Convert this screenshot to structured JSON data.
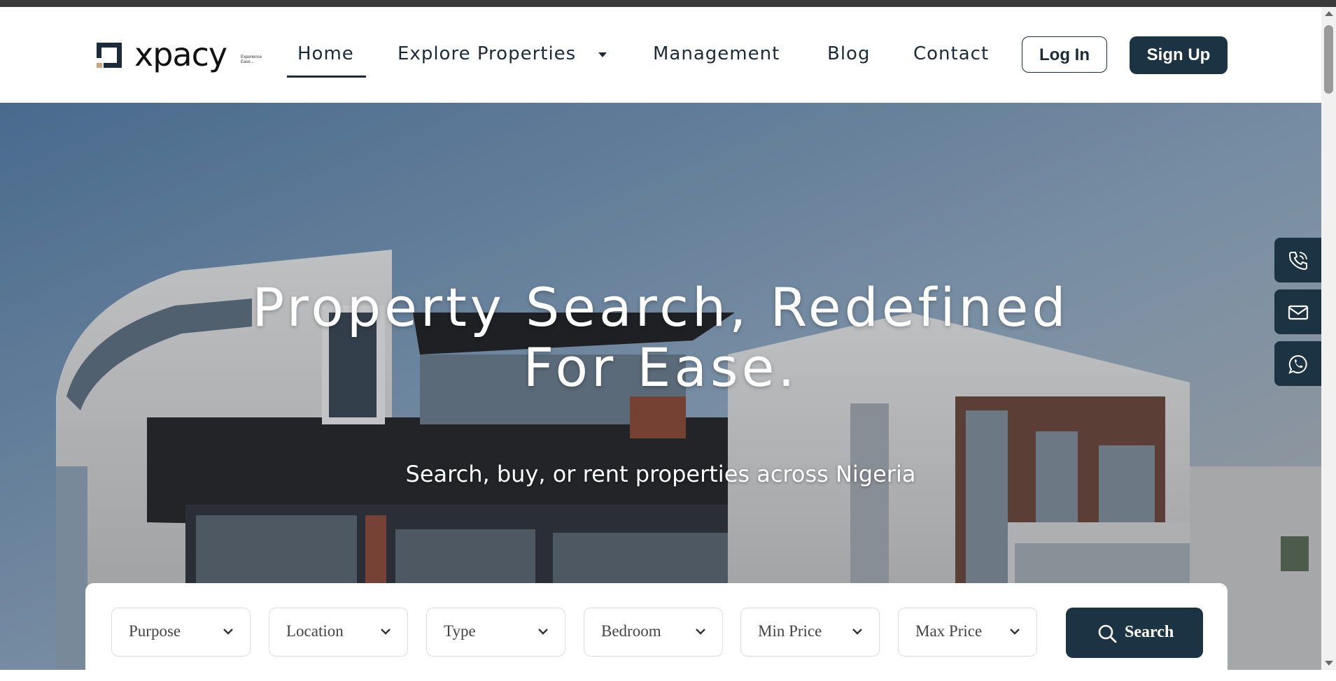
{
  "brand": {
    "name": "xpacy",
    "tagline": "Experience Ease..."
  },
  "nav": {
    "items": [
      {
        "label": "Home",
        "active": true
      },
      {
        "label": "Explore Properties",
        "has_dropdown": true
      },
      {
        "label": "Management"
      },
      {
        "label": "Blog"
      },
      {
        "label": "Contact"
      }
    ],
    "login_label": "Log In",
    "signup_label": "Sign Up"
  },
  "hero": {
    "title_line1": "Property Search, Redefined",
    "title_line2": "For Ease.",
    "subtitle": "Search, buy, or rent properties across Nigeria"
  },
  "search": {
    "fields": [
      {
        "label": "Purpose"
      },
      {
        "label": "Location"
      },
      {
        "label": "Type"
      },
      {
        "label": "Bedroom"
      },
      {
        "label": "Min Price"
      },
      {
        "label": "Max Price"
      }
    ],
    "button_label": "Search"
  },
  "dock": {
    "items": [
      "phone-icon",
      "mail-icon",
      "whatsapp-icon"
    ]
  },
  "colors": {
    "primary": "#1c3344",
    "text": "#1c2b3a",
    "logo_accent": "#c9a77a"
  }
}
